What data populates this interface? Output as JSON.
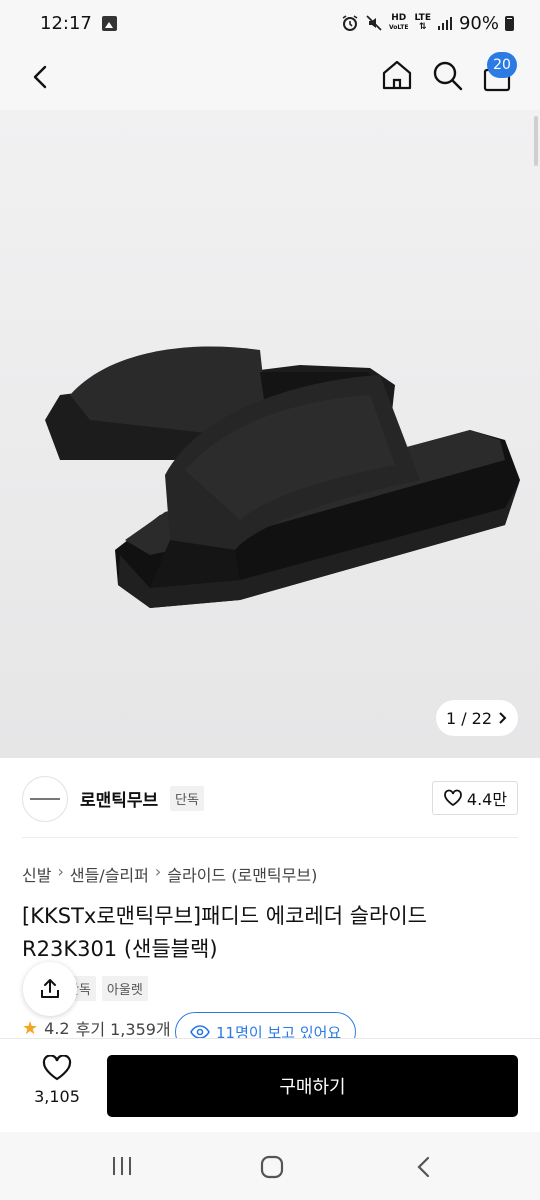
{
  "status_bar": {
    "time": "12:17",
    "hd_label": "HD",
    "voice_label": "VoLTE",
    "lte_label": "LTE",
    "battery": "90%"
  },
  "header": {
    "cart_count": "20"
  },
  "gallery": {
    "counter": "1 / 22"
  },
  "brand": {
    "name": "로맨틱무브",
    "tag": "단독",
    "likes": "4.4만"
  },
  "breadcrumb": [
    "신발",
    "샌들/슬리퍼",
    "슬라이드 (로맨틱무브)"
  ],
  "product": {
    "title": "[KKSTx로맨틱무브]패디드 에코레더 슬라이드 R23K301 (샌들블랙)",
    "tags": [
      "단독",
      "아울렛"
    ],
    "rating": "4.2",
    "reviews": "후기 1,359개",
    "viewers": "11명이 보고 있어요"
  },
  "bottom_bar": {
    "wish_count": "3,105",
    "buy_label": "구매하기"
  },
  "colors": {
    "accent": "#2c7be5",
    "star": "#f3a51d",
    "buy_button": "#000000"
  }
}
